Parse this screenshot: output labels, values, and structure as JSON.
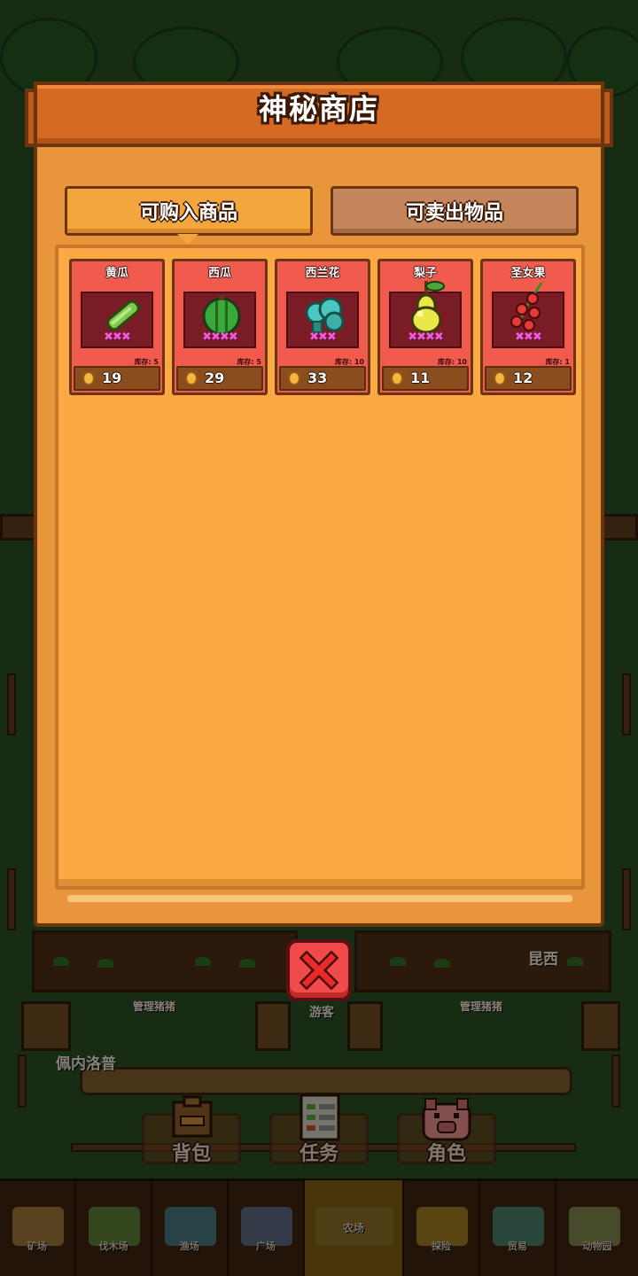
{
  "shop": {
    "title": "神秘商店",
    "tabs": [
      {
        "label": "可购入商品",
        "active": true
      },
      {
        "label": "可卖出物品",
        "active": false
      }
    ],
    "items": [
      {
        "name": "黄瓜",
        "icon": "cucumber-icon",
        "stars": "✖✖✖",
        "stock": "库存: 5",
        "price": "19"
      },
      {
        "name": "西瓜",
        "icon": "watermelon-icon",
        "stars": "✖✖✖✖",
        "stock": "库存: 5",
        "price": "29"
      },
      {
        "name": "西兰花",
        "icon": "broccoli-icon",
        "stars": "✖✖✖",
        "stock": "库存: 10",
        "price": "33"
      },
      {
        "name": "梨子",
        "icon": "pear-icon",
        "stars": "✖✖✖✖",
        "stock": "库存: 10",
        "price": "11"
      },
      {
        "name": "圣女果",
        "icon": "cherry-tomato-icon",
        "stars": "✖✖✖",
        "stock": "库存: 1",
        "price": "12"
      }
    ]
  },
  "map": {
    "labels": [
      "管理猪猪",
      "游客",
      "管理猪猪",
      "昆西",
      "佩内洛普"
    ]
  },
  "hud": {
    "buttons": [
      {
        "label": "背包",
        "icon": "backpack-icon"
      },
      {
        "label": "任务",
        "icon": "task-list-icon"
      },
      {
        "label": "角色",
        "icon": "pig-character-icon"
      }
    ]
  },
  "nav": {
    "items": [
      {
        "label": "矿场",
        "icon": "mine-icon",
        "active": false
      },
      {
        "label": "伐木场",
        "icon": "lumber-icon",
        "active": false
      },
      {
        "label": "渔场",
        "icon": "fishery-icon",
        "active": false
      },
      {
        "label": "广场",
        "icon": "plaza-icon",
        "active": false
      },
      {
        "label": "农场",
        "icon": "farm-icon",
        "active": true
      },
      {
        "label": "探险",
        "icon": "explore-icon",
        "active": false
      },
      {
        "label": "贸易",
        "icon": "trade-icon",
        "active": false
      },
      {
        "label": "动物园",
        "icon": "zoo-icon",
        "active": false
      }
    ]
  },
  "colors": {
    "panel": "#e9953c",
    "title_bar": "#d46a24",
    "card": "#f05b4d",
    "close_button": "#f04a4a",
    "nav_active": "#7a5a14"
  }
}
